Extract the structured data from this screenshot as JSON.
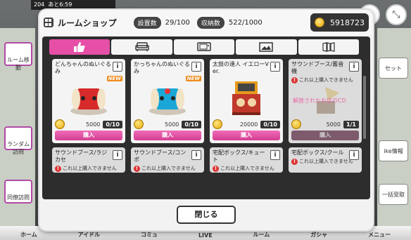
{
  "background": {
    "top_left_status": "204",
    "top_left_time": "あと6:59",
    "left_buttons": [
      "ルーム移動",
      "ランダム訪問",
      "同僚訪問"
    ],
    "right_buttons": [
      "セット",
      "ike情報",
      "一括受取"
    ],
    "bottom_nav": [
      "ホーム",
      "アイドル",
      "コミュ",
      "LIVE",
      "ルーム",
      "ガシャ",
      "メニュー"
    ]
  },
  "shop": {
    "title": "ルームショップ",
    "placed_label": "設置数",
    "placed_value": "29/100",
    "storage_label": "収納数",
    "storage_value": "522/1000",
    "coin_amount": "5918723",
    "close_label": "閉じる"
  },
  "tabs": [
    {
      "name": "thumbs-up-icon",
      "active": true
    },
    {
      "name": "sofa-icon",
      "active": false
    },
    {
      "name": "tv-icon",
      "active": false
    },
    {
      "name": "picture-icon",
      "active": false
    },
    {
      "name": "wallpaper-icon",
      "active": false
    }
  ],
  "items": [
    {
      "name": "どんちゃんのぬいぐるみ",
      "new": "NEW",
      "price": "5000",
      "owned": "0/10",
      "buy": "購入",
      "color": "#d72a2a"
    },
    {
      "name": "かっちゃんのぬいぐるみ",
      "new": "NEW",
      "price": "5000",
      "owned": "0/10",
      "buy": "購入",
      "color": "#1aa6d6"
    },
    {
      "name": "太鼓の達人 イエローVer.",
      "new": "",
      "price": "20000",
      "owned": "0/10",
      "buy": "購入",
      "color": "#e79a1c"
    },
    {
      "name": "サウンドブース/蓄音機",
      "warn": "これ以上購入できません",
      "price": "5000",
      "owned": "1/1",
      "buy": "購入",
      "disabled_text": "解放されたお店のCD",
      "color": "#c9a53a"
    }
  ],
  "items_row2": [
    {
      "name": "サウンドブース/ラジカセ",
      "warn": "これ以上購入できません"
    },
    {
      "name": "サウンドブース/コンポ",
      "warn": "これ以上購入できません"
    },
    {
      "name": "宅配ボックス/キュート",
      "warn": "これ以上購入できません"
    },
    {
      "name": "宅配ボックス/クール",
      "warn": "これ以上購入できません"
    }
  ],
  "labels": {
    "info": "i",
    "warn_mark": "!"
  }
}
